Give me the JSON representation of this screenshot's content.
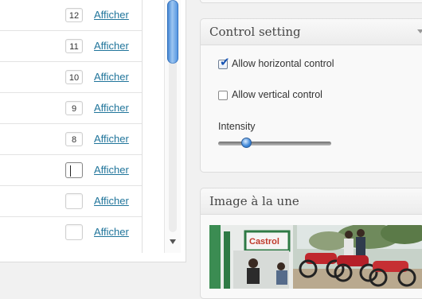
{
  "rows": [
    {
      "order": "12",
      "link": "Afficher"
    },
    {
      "order": "11",
      "link": "Afficher"
    },
    {
      "order": "10",
      "link": "Afficher"
    },
    {
      "order": "9",
      "link": "Afficher"
    },
    {
      "order": "8",
      "link": "Afficher"
    },
    {
      "order": "",
      "link": "Afficher"
    },
    {
      "order": "",
      "link": "Afficher"
    },
    {
      "order": "",
      "link": "Afficher"
    }
  ],
  "control": {
    "title": "Control setting",
    "horizontal_label": "Allow horizontal control",
    "horizontal_checked": true,
    "vertical_label": "Allow vertical control",
    "vertical_checked": false,
    "intensity_label": "Intensity",
    "intensity_value": 0.25
  },
  "featured": {
    "title": "Image à la une",
    "sign_text": "Castrol"
  },
  "colors": {
    "link": "#21759b",
    "accent": "#3c86d8"
  },
  "icons": {
    "check": "checkmark-icon",
    "toggle": "chevron-down-icon",
    "scroll_down": "arrow-down-icon"
  }
}
